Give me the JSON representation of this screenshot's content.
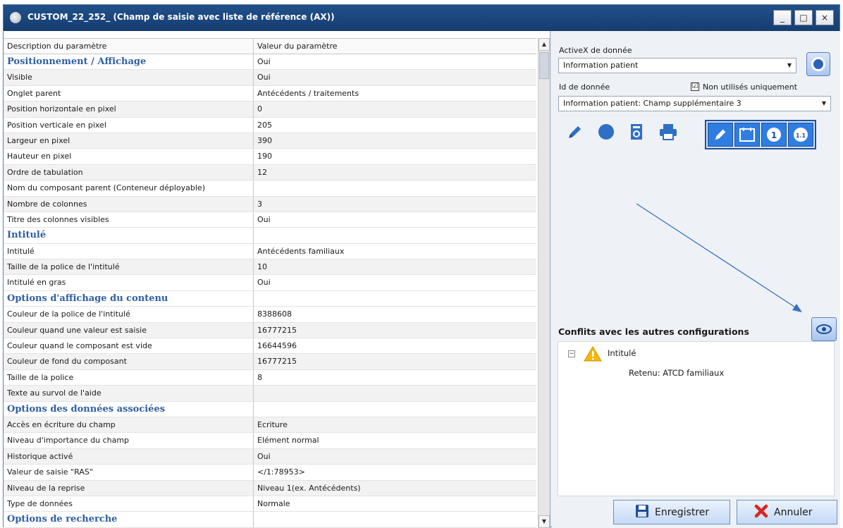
{
  "window": {
    "title": "CUSTOM_22_252_ (Champ de saisie avec liste de référence (AX))",
    "minimize": "_",
    "maximize": "□",
    "close": "×"
  },
  "grid": {
    "header": {
      "col1": "Description du paramètre",
      "col2": "Valeur du paramètre"
    },
    "rows": [
      {
        "label": "Positionnement / Affichage",
        "value": "Oui",
        "section": true
      },
      {
        "label": "Visible",
        "value": "Oui"
      },
      {
        "label": "Onglet parent",
        "value": "Antécédents / traitements"
      },
      {
        "label": "Position horizontale en pixel",
        "value": "0"
      },
      {
        "label": "Position verticale en pixel",
        "value": "205"
      },
      {
        "label": "Largeur en pixel",
        "value": "390"
      },
      {
        "label": "Hauteur en pixel",
        "value": "190"
      },
      {
        "label": "Ordre de tabulation",
        "value": "12"
      },
      {
        "label": "Nom du composant parent (Conteneur déployable)",
        "value": ""
      },
      {
        "label": "Nombre de colonnes",
        "value": "3"
      },
      {
        "label": "Titre des colonnes visibles",
        "value": "Oui"
      },
      {
        "label": "Intitulé",
        "value": "",
        "section": true
      },
      {
        "label": "Intitulé",
        "value": "Antécédents familiaux"
      },
      {
        "label": "Taille de la police de l'intitulé",
        "value": "10"
      },
      {
        "label": "Intitulé en gras",
        "value": "Oui"
      },
      {
        "label": "Options d'affichage du contenu",
        "value": "",
        "section": true
      },
      {
        "label": "Couleur de la police de l'intitulé",
        "value": "8388608"
      },
      {
        "label": "Couleur quand une valeur est saisie",
        "value": "16777215"
      },
      {
        "label": "Couleur quand le composant est vide",
        "value": "16644596"
      },
      {
        "label": "Couleur de fond du composant",
        "value": "16777215"
      },
      {
        "label": "Taille de la police",
        "value": "8"
      },
      {
        "label": "Texte au survol de l'aide",
        "value": ""
      },
      {
        "label": "Options des données associées",
        "value": "",
        "section": true
      },
      {
        "label": "Accès en écriture du champ",
        "value": "Ecriture"
      },
      {
        "label": "Niveau d'importance du champ",
        "value": "Elément normal"
      },
      {
        "label": "Historique activé",
        "value": "Oui"
      },
      {
        "label": "Valeur de saisie \"RAS\"",
        "value": "</1:78953>"
      },
      {
        "label": "Niveau de la reprise",
        "value": "Niveau 1(ex. Antécédents)"
      },
      {
        "label": "Type de données",
        "value": "Normale"
      },
      {
        "label": "Options de recherche",
        "value": "",
        "section": true
      }
    ]
  },
  "panel": {
    "activex_label": "ActiveX de donnée",
    "activex_value": "Information patient",
    "id_label": "Id de donnée",
    "unused_only_label": "Non utilisés uniquement",
    "unused_only_checked": "☑",
    "id_value": "Information patient: Champ supplémentaire 3",
    "conflicts_title": "Conflits avec les autres configurations",
    "tree_node": "Intitulé",
    "tree_child": "Retenu: ATCD familiaux",
    "save_label": "Enregistrer",
    "cancel_label": "Annuler"
  },
  "icons": {
    "edit": "pencil-icon",
    "dot": "circle-icon",
    "doc": "document-refresh-icon",
    "print": "printer-icon",
    "calendar": "calendar-icon",
    "one": "1",
    "onepointone": "1.1"
  },
  "colors": {
    "titlebar": "#1c4a82",
    "accent_blue": "#2f7de1",
    "section_text": "#2e5fa3",
    "cancel_x": "#d9261c"
  }
}
